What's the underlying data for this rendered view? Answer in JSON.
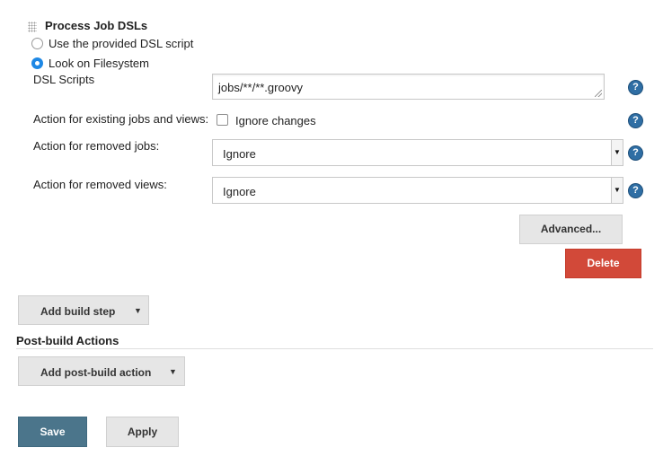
{
  "section": {
    "title": "Process Job DSLs",
    "radio_use_provided": "Use the provided DSL script",
    "radio_look_on_fs": "Look on Filesystem",
    "dsl_scripts_label": "DSL Scripts",
    "dsl_scripts_value": "jobs/**/**.groovy",
    "existing_label": "Action for existing jobs and views:",
    "ignore_changes_label": "Ignore changes",
    "removed_jobs_label": "Action for removed jobs:",
    "removed_jobs_value": "Ignore",
    "removed_views_label": "Action for removed views:",
    "removed_views_value": "Ignore",
    "advanced_label": "Advanced...",
    "delete_label": "Delete"
  },
  "build": {
    "add_build_step_label": "Add build step"
  },
  "post_build": {
    "heading": "Post-build Actions",
    "add_post_build_label": "Add post-build action"
  },
  "footer": {
    "save_label": "Save",
    "apply_label": "Apply"
  },
  "colors": {
    "primary_blue": "#4b758b",
    "delete_red": "#d24939",
    "radio_blue": "#1e88e5",
    "help_blue": "#2f6ea4"
  },
  "help_icon_glyph": "?"
}
